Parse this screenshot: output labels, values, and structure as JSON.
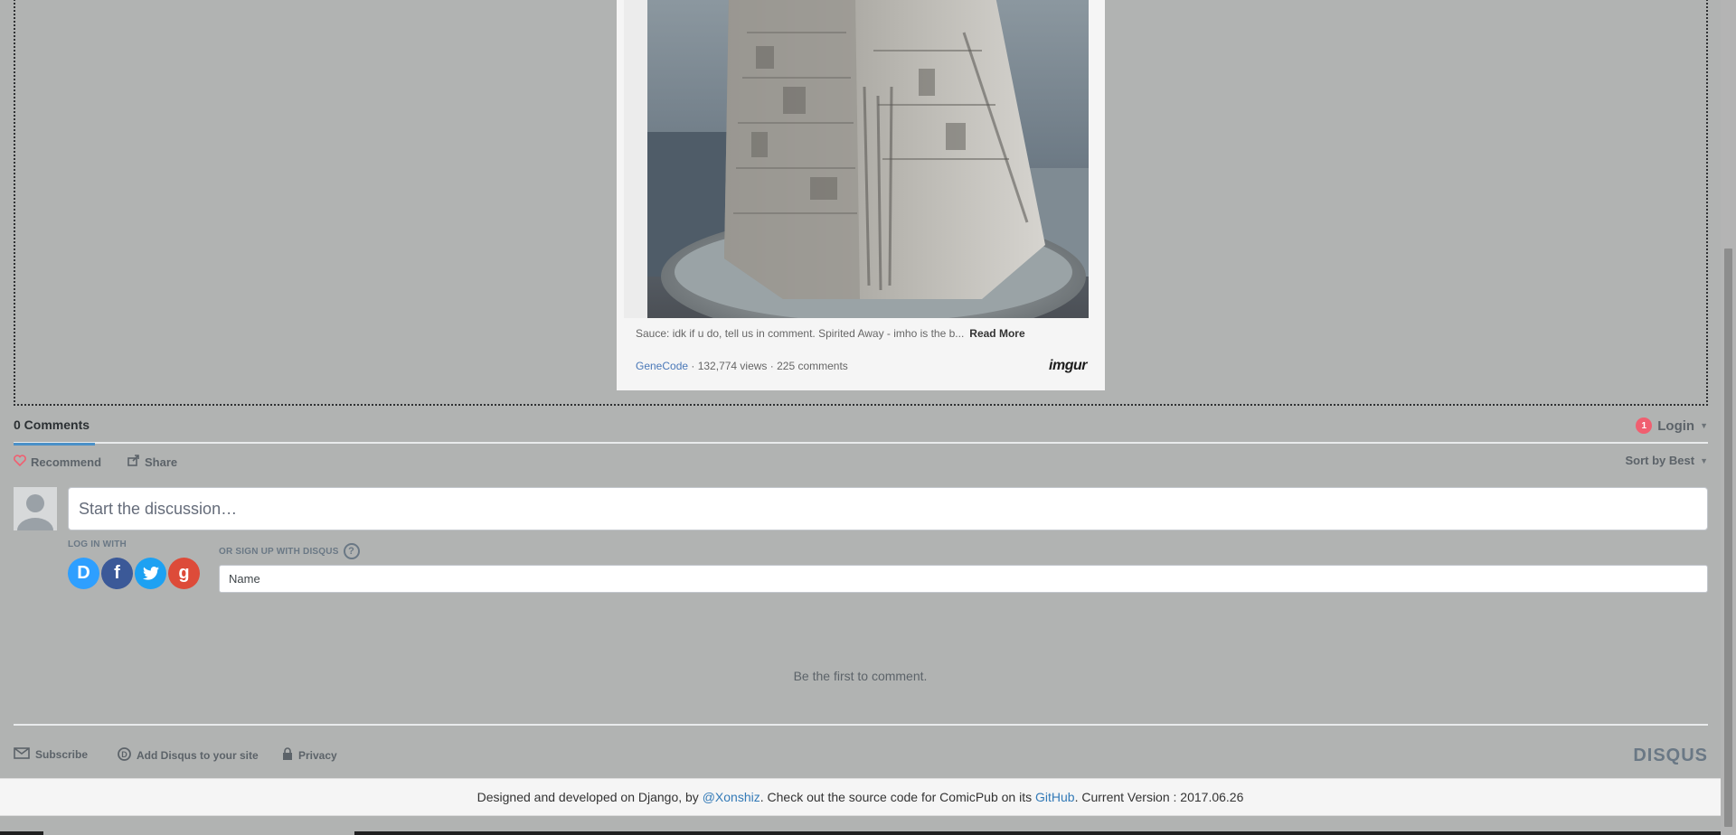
{
  "imgur": {
    "caption": "Sauce: idk if u do, tell us in comment. Spirited Away - imho is the b...",
    "read_more": "Read More",
    "author": "GeneCode",
    "stats": " · 132,774 views · 225 comments",
    "logo": "imgur"
  },
  "disqus": {
    "comments_tab": "0 Comments",
    "login_badge": "1",
    "login_label": "Login",
    "recommend_label": "Recommend",
    "share_label": "Share",
    "sort_label": "Sort by Best",
    "discussion_placeholder": "Start the discussion…",
    "login_with_label": "LOG IN WITH",
    "signup_label": "OR SIGN UP WITH DISQUS",
    "name_placeholder": "Name",
    "social": [
      "D",
      "f",
      "",
      "g"
    ],
    "empty_message": "Be the first to comment.",
    "footer": {
      "subscribe": "Subscribe",
      "add_disqus": "Add Disqus to your site",
      "privacy": "Privacy",
      "logo": "DISQUS"
    }
  },
  "site_footer": {
    "prefix": "Designed and developed on Django, by ",
    "author_link": "@Xonshiz",
    "middle": ". Check out the source code for ComicPub on its ",
    "github_link": "GitHub",
    "suffix": ". Current Version : 2017.06.26"
  }
}
